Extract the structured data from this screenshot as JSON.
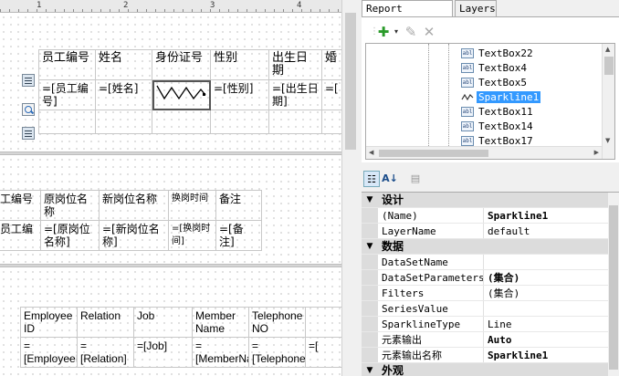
{
  "ruler": {
    "marks": [
      "1",
      "2",
      "3",
      "4"
    ]
  },
  "band1": {
    "headers": [
      "员工编号",
      "姓名",
      "身份证号",
      "性别",
      "出生日期",
      "婚"
    ],
    "values": [
      "=[员工编号]",
      "=[姓名]",
      "",
      "=[性别]",
      "=[出生日期]",
      "=["
    ]
  },
  "band2": {
    "headers": [
      "工编号",
      "原岗位名称",
      "新岗位名称",
      "换岗时间",
      "备注"
    ],
    "values": [
      "员工编",
      "=[原岗位名称]",
      "=[新岗位名称]",
      "=[换岗时间]",
      "=[备注]"
    ]
  },
  "band3": {
    "headers": [
      "Employee ID",
      "Relation",
      "Job",
      "Member Name",
      "Telephone NO"
    ],
    "values": [
      "=[EmployeeID]",
      "=[Relation]",
      "=[Job]",
      "=[MemberName]",
      "=[TelephoneNO]",
      "=["
    ]
  },
  "tabs": {
    "report_explorer": "Report Explorer",
    "layers": "Layers"
  },
  "tree": {
    "items": [
      "TextBox22",
      "TextBox4",
      "TextBox5",
      "Sparkline1",
      "TextBox11",
      "TextBox14",
      "TextBox17"
    ],
    "selected": "Sparkline1"
  },
  "props": {
    "cat_design": "设计",
    "name_label": "(Name)",
    "name_value": "Sparkline1",
    "layername_label": "LayerName",
    "layername_value": "default",
    "cat_data": "数据",
    "datasetname_label": "DataSetName",
    "datasetname_value": "",
    "datasetparams_label": "DataSetParameters",
    "datasetparams_value": "(集合)",
    "filters_label": "Filters",
    "filters_value": "(集合)",
    "seriesvalue_label": "SeriesValue",
    "seriesvalue_value": "",
    "sparktype_label": "SparklineType",
    "sparktype_value": "Line",
    "output_label": "元素输出",
    "output_value": "Auto",
    "outputname_label": "元素输出名称",
    "outputname_value": "Sparkline1",
    "cat_appearance": "外观"
  }
}
